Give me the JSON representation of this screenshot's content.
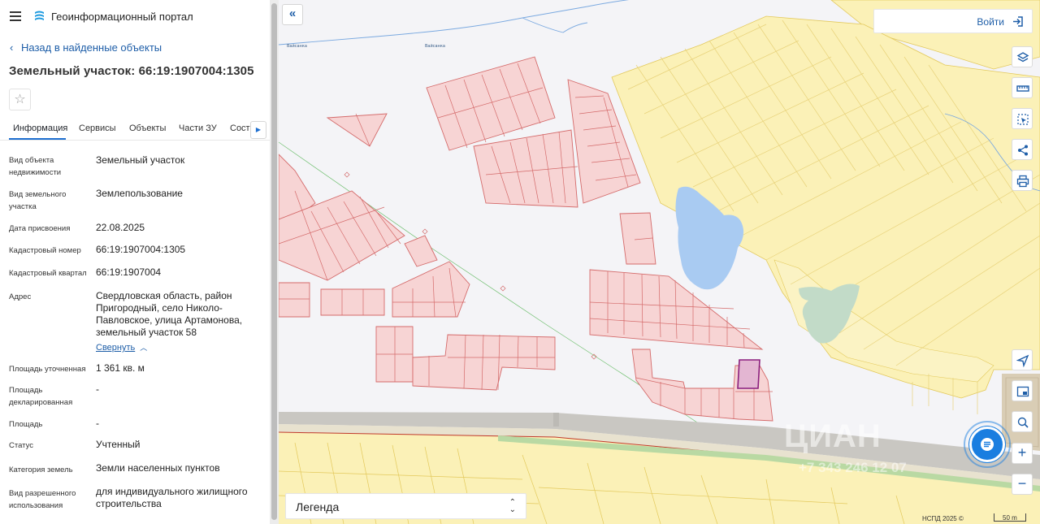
{
  "app": {
    "title": "Геоинформационный портал"
  },
  "nav": {
    "back_label": "Назад в найденные объекты"
  },
  "parcel": {
    "title": "Земельный участок: 66:19:1907004:1305",
    "favorite_icon": "star-icon"
  },
  "tabs": [
    {
      "label": "Информация",
      "active": true
    },
    {
      "label": "Сервисы",
      "active": false
    },
    {
      "label": "Объекты",
      "active": false
    },
    {
      "label": "Части ЗУ",
      "active": false
    },
    {
      "label": "Состав",
      "active": false
    }
  ],
  "info": {
    "rows": [
      {
        "label": "Вид объекта недвижимости",
        "value": "Земельный участок"
      },
      {
        "label": "Вид земельного участка",
        "value": "Землепользование"
      },
      {
        "label": "Дата присвоения",
        "value": "22.08.2025"
      },
      {
        "label": "Кадастровый номер",
        "value": "66:19:1907004:1305"
      },
      {
        "label": "Кадастровый квартал",
        "value": "66:19:1907004"
      },
      {
        "label": "Адрес",
        "value": "Свердловская область, район Пригородный, село Николо-Павловское, улица Артамонова, земельный участок 58"
      },
      {
        "label": "Площадь уточненная",
        "value": "1 361 кв. м"
      },
      {
        "label": "Площадь декларированная",
        "value": "-"
      },
      {
        "label": "Площадь",
        "value": "-"
      },
      {
        "label": "Статус",
        "value": "Учтенный"
      },
      {
        "label": "Категория земель",
        "value": "Земли населенных пунктов"
      },
      {
        "label": "Вид разрешенного использования",
        "value": "для индивидуального жилищного строительства"
      }
    ],
    "collapse_label": "Свернуть"
  },
  "map": {
    "login_label": "Войти",
    "legend_label": "Легенда",
    "copyright": "НСПД 2025 ©",
    "scale_label": "50 m",
    "watermark": "ЦИАН",
    "watermark_phone": "+7 343 246 12 07",
    "river_label_1": "Вайсанка",
    "river_label_2": "Вайсанка",
    "tools": [
      "layers-icon",
      "ruler-icon",
      "select-area-icon",
      "share-icon",
      "print-icon"
    ],
    "side_tools": [
      "locate-icon",
      "minimap-icon",
      "search-map-icon"
    ],
    "zoom_in": "+",
    "zoom_out": "−",
    "colors": {
      "parcel_fill": "#f7d4d4",
      "parcel_stroke": "#d46a6a",
      "selected_fill": "#e3b6d2",
      "selected_stroke": "#8a1f7e",
      "settlement_fill": "#fbf1b7",
      "settlement_stroke": "#e3c95c",
      "water": "#a9cbf2",
      "forest": "#c2dbc8",
      "accent": "#1e5ea8"
    }
  }
}
